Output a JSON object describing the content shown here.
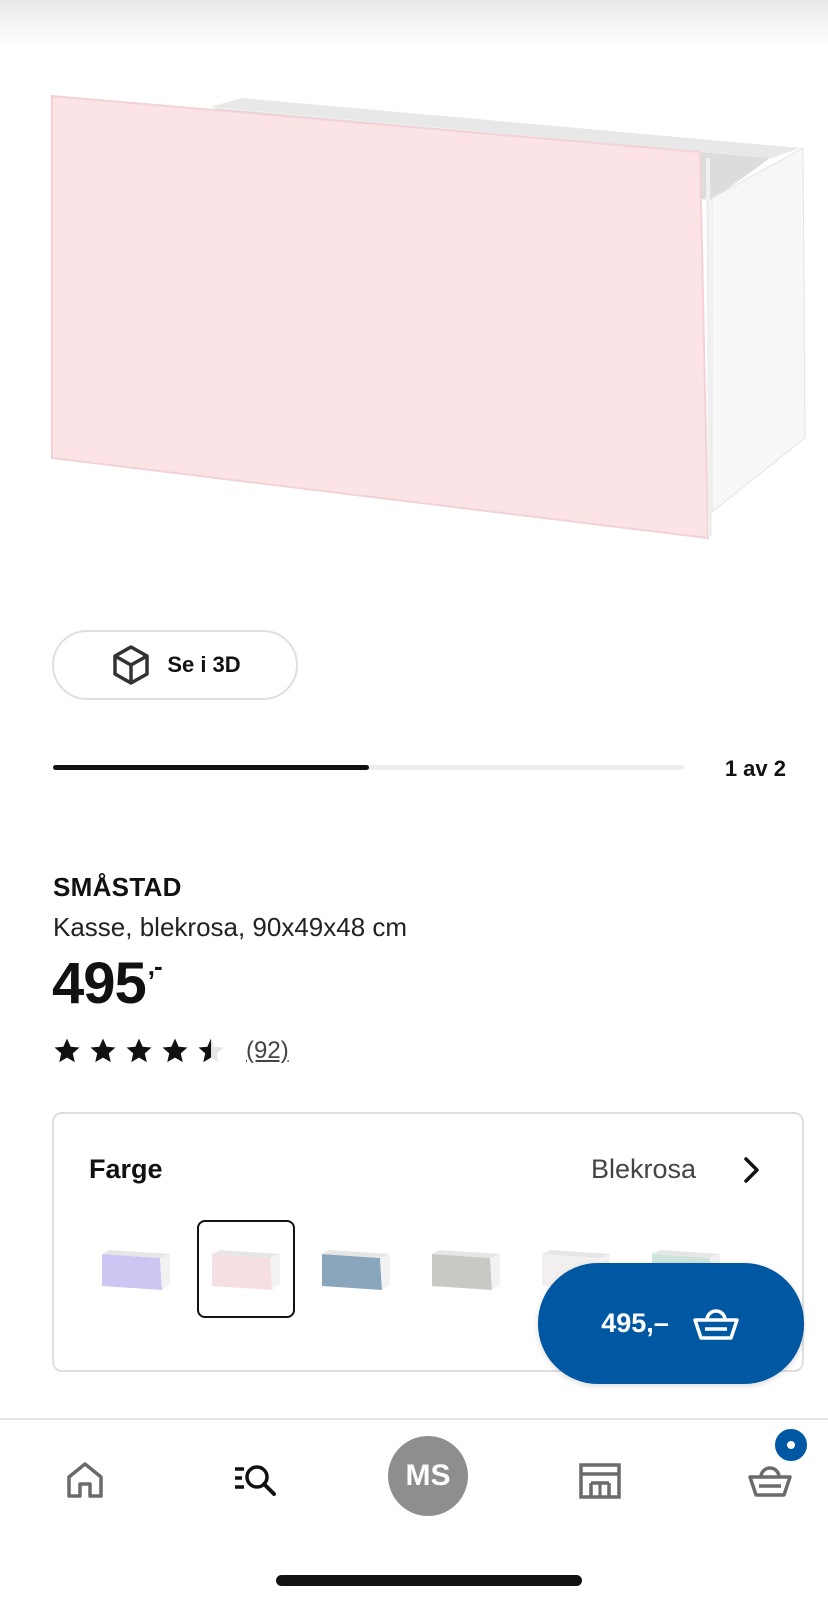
{
  "product": {
    "name": "SMÅSTAD",
    "description": "Kasse, blekrosa, 90x49x48 cm",
    "price_whole": "495",
    "price_suffix": ",-",
    "rating": 4.5,
    "rating_max": 5,
    "review_count": "(92)"
  },
  "gallery": {
    "view_3d_label": "Se i 3D",
    "page_indicator": "1 av 2",
    "progress": 0.5
  },
  "color_selector": {
    "title": "Farge",
    "selected_value": "Blekrosa",
    "swatches": [
      {
        "name": "lavender",
        "color": "#cdc6f2"
      },
      {
        "name": "pale-pink",
        "color": "#f6dfe2"
      },
      {
        "name": "blue",
        "color": "#8aa6bc"
      },
      {
        "name": "grey",
        "color": "#c9c8c4"
      },
      {
        "name": "white",
        "color": "#f1f0ee"
      },
      {
        "name": "mint",
        "color": "#cde4da"
      }
    ],
    "selected_index": 1
  },
  "add_to_cart": {
    "label": "495,–"
  },
  "nav": {
    "items": [
      "home-icon",
      "search-icon",
      "profile-avatar",
      "store-icon",
      "cart-icon"
    ],
    "avatar_initials": "MS"
  },
  "colors": {
    "accent": "#0058a3",
    "product_front": "#fbe3e6",
    "text": "#111111"
  }
}
